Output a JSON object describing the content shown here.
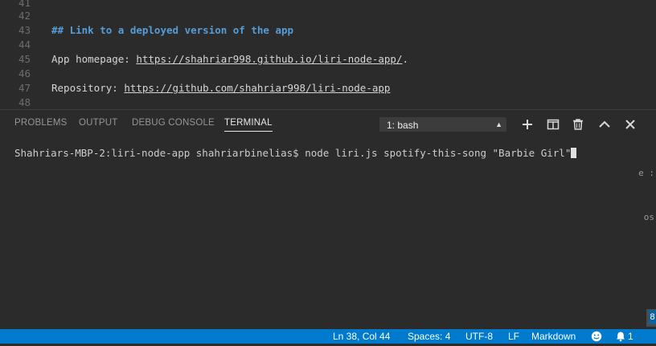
{
  "editor": {
    "lines": [
      {
        "num": "41",
        "text": ""
      },
      {
        "num": "42",
        "text": ""
      },
      {
        "num": "43",
        "text": "## Link to a deployed version of the app"
      },
      {
        "num": "44",
        "text": ""
      },
      {
        "num": "45",
        "prefix": "App homepage: ",
        "link": "https://shahriar998.github.io/liri-node-app/",
        "suffix": "."
      },
      {
        "num": "46",
        "text": ""
      },
      {
        "num": "47",
        "prefix": "Repository: ",
        "link": "https://github.com/shahriar998/liri-node-app",
        "suffix": ""
      },
      {
        "num": "48",
        "text": ""
      }
    ]
  },
  "panel": {
    "tabs": {
      "problems": "PROBLEMS",
      "output": "OUTPUT",
      "debug_console": "DEBUG CONSOLE",
      "terminal": "TERMINAL"
    },
    "active_tab": "TERMINAL",
    "terminal_select": "1: bash",
    "icons": [
      "plus-icon",
      "split-terminal-icon",
      "trash-icon",
      "chevron-up-icon",
      "close-icon"
    ],
    "terminal_line": "Shahriars-MBP-2:liri-node-app shahriarbinelias$ node liri.js spotify-this-song \"Barbie Girl\""
  },
  "edge_fragments": [
    "e :",
    "os"
  ],
  "scroll_badge": "8",
  "statusbar": {
    "position": "Ln 38, Col 44",
    "spaces": "Spaces: 4",
    "encoding": "UTF-8",
    "eol": "LF",
    "language": "Markdown",
    "notifications": "1"
  },
  "colors": {
    "statusbar_bg": "#007acc",
    "heading": "#569cd6",
    "background": "#2b2b2b"
  }
}
